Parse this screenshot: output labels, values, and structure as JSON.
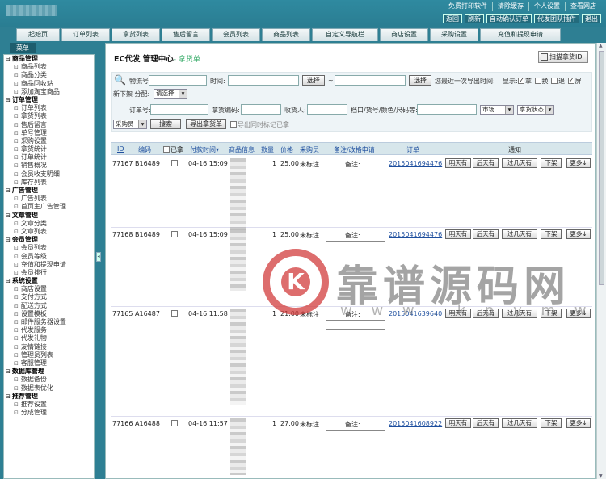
{
  "header": {
    "links": [
      "免费打印软件",
      "清除缓存",
      "个人设置",
      "查看网店"
    ],
    "buttons": [
      "返回",
      "刷新",
      "自动确认订单",
      "代发团队插件",
      "退出"
    ]
  },
  "nav_tabs": [
    "起始页",
    "订单列表",
    "拿货列表",
    "售后留言",
    "会员列表",
    "商品列表",
    "自定义导航栏",
    "商店设置",
    "采购设置",
    "充值和提现申请"
  ],
  "menu": {
    "title": "菜单",
    "groups": [
      {
        "label": "商品管理",
        "items": [
          "商品列表",
          "商品分类",
          "商品回收站",
          "添加淘宝商品"
        ]
      },
      {
        "label": "订单管理",
        "items": [
          "订单列表",
          "拿货列表",
          "售后留言",
          "单号管理",
          "采购设置",
          "拿货统计",
          "订单统计",
          "销售概况",
          "会员收支明细",
          "库存列表"
        ]
      },
      {
        "label": "广告管理",
        "items": [
          "广告列表",
          "首页主广告管理"
        ]
      },
      {
        "label": "文章管理",
        "items": [
          "文章分类",
          "文章列表"
        ]
      },
      {
        "label": "会员管理",
        "items": [
          "会员列表",
          "会员等级",
          "充值和提现申请",
          "会员排行"
        ]
      },
      {
        "label": "系统设置",
        "items": [
          "商店设置",
          "支付方式",
          "配送方式",
          "设置模板",
          "邮件服务器设置",
          "代发服务",
          "代发礼物",
          "友情链接",
          "管理员列表",
          "客服管理"
        ]
      },
      {
        "label": "数据库管理",
        "items": [
          "数据备份",
          "数据表优化"
        ]
      },
      {
        "label": "推荐管理",
        "items": [
          "推荐设置",
          "分成管理"
        ]
      }
    ]
  },
  "main": {
    "title": "EC代发 管理中心",
    "subtitle": "- 拿货单",
    "scan_button": "扫描拿货ID"
  },
  "filter": {
    "waybill_label": "物流号:",
    "time_label": "时间:",
    "select_btn": "选择",
    "tilde": "~",
    "last_export": "您最近一次导出时间:",
    "show_label": "显示:",
    "show_options": [
      {
        "label": "拿",
        "checked": true
      },
      {
        "label": "换",
        "checked": false
      },
      {
        "label": "退",
        "checked": false
      },
      {
        "label": "屏",
        "checked": true
      }
    ],
    "shelf_label": "新下架 分配:",
    "assign_select": "请选择",
    "order_no_label": "订单号:",
    "goods_code_label": "拿货编码:",
    "receiver_label": "收货人:",
    "stall_label": "档口/货号/颜色/尺码等:",
    "market_select": "市场..",
    "status_select": "拿货状态",
    "buyer_select": "采购员",
    "search_btn": "搜索",
    "export_btn": "导出拿货单",
    "export_mark": "导出同时标记已拿"
  },
  "table": {
    "headers": [
      "ID",
      "编码",
      "已拿",
      "付款时间▾",
      "商品信息",
      "数量",
      "价格",
      "采购员",
      "备注/改格申请",
      "订单",
      "通知"
    ],
    "rows": [
      {
        "id": "77167",
        "code": "B16489",
        "time": "04-16 15:09",
        "qty": "1",
        "price": "25.00",
        "buyer": "未标注",
        "note": "备注:",
        "order": "2015041694476"
      },
      {
        "id": "77168",
        "code": "B16489",
        "time": "04-16 15:09",
        "qty": "1",
        "price": "25.00",
        "buyer": "未标注",
        "note": "备注:",
        "order": "2015041694476"
      },
      {
        "id": "77165",
        "code": "A16487",
        "time": "04-16 11:58",
        "qty": "1",
        "price": "21.00",
        "buyer": "未标注",
        "note": "备注:",
        "order": "2015041639640"
      },
      {
        "id": "77166",
        "code": "A16488",
        "time": "04-16 11:57",
        "qty": "1",
        "price": "27.00",
        "buyer": "未标注",
        "note": "备注:",
        "order": "2015041608922"
      }
    ],
    "actions": [
      "明天有",
      "后天有",
      "过几天有",
      "下架",
      "更多↓"
    ]
  },
  "watermark": {
    "text": "靠谱源码网",
    "url": "w w w . k p y m w . c o m",
    "logo": "K"
  }
}
